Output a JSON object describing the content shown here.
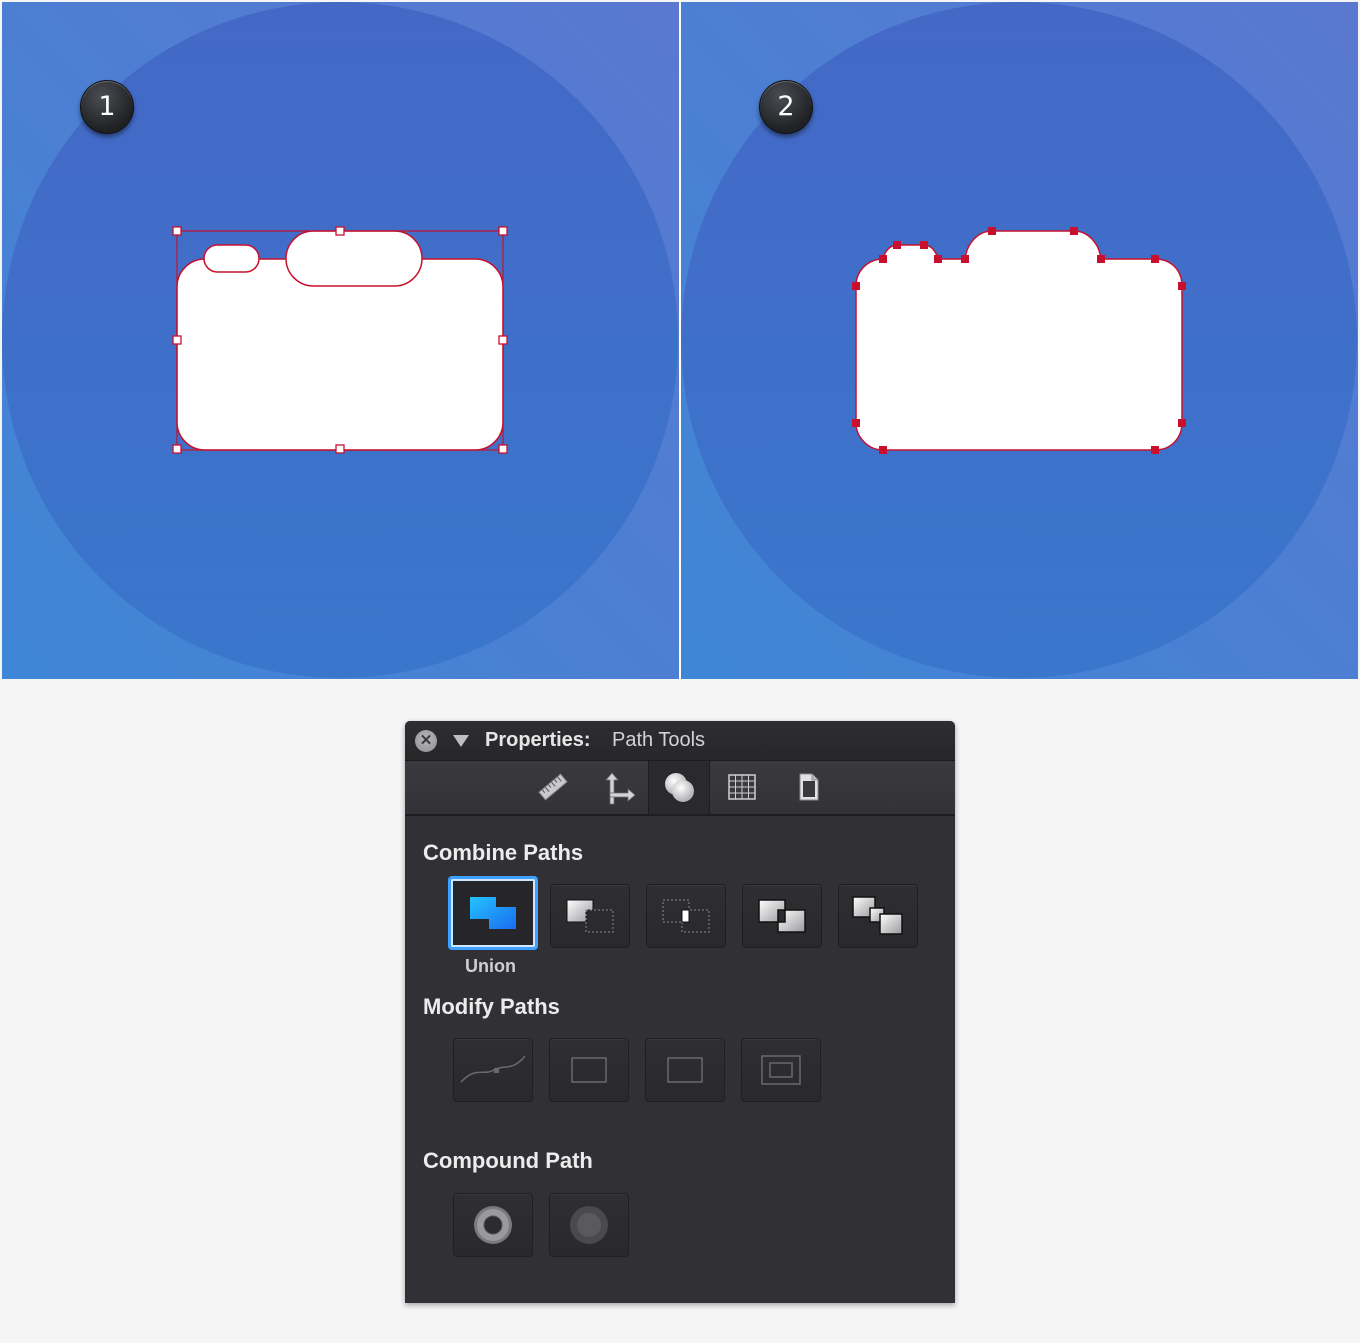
{
  "canvas": {
    "step1_label": "1",
    "step2_label": "2",
    "background_color": "#4775cc",
    "shape_fill": "#ffffff",
    "path_stroke_color": "#c8102e"
  },
  "properties_panel": {
    "title_label": "Properties:",
    "title_value": "Path Tools",
    "tabs": [
      {
        "icon": "ruler-icon"
      },
      {
        "icon": "move-arrows-icon"
      },
      {
        "icon": "path-combine-icon",
        "active": true
      },
      {
        "icon": "grid-icon"
      },
      {
        "icon": "document-icon"
      }
    ],
    "combine_paths": {
      "title": "Combine Paths",
      "selected_label": "Union",
      "buttons": [
        "union",
        "subtract",
        "intersect",
        "exclude",
        "divide"
      ]
    },
    "modify_paths": {
      "title": "Modify Paths",
      "buttons": [
        "smooth-path",
        "rectangle-path",
        "square-path",
        "inset-path"
      ]
    },
    "compound_path": {
      "title": "Compound Path",
      "buttons": [
        "make-compound",
        "release-compound"
      ]
    },
    "accent_color": "#3ea0ff"
  }
}
